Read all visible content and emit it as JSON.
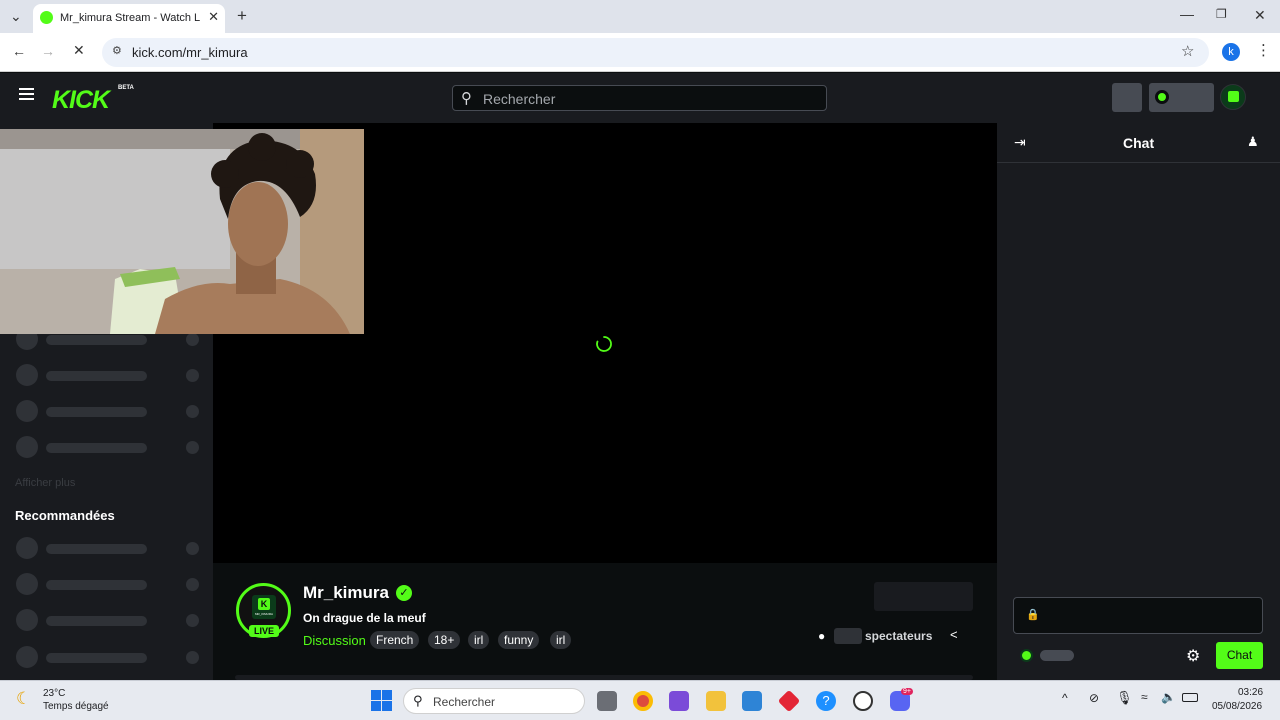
{
  "browser": {
    "tab_title": "Mr_kimura Stream - Watch Live",
    "url": "kick.com/mr_kimura",
    "profile_initial": "k"
  },
  "kick": {
    "logo_text": "KICK",
    "logo_badge": "BETA",
    "search_placeholder": "Rechercher"
  },
  "sidebar": {
    "show_more": "Afficher plus",
    "recommended_heading": "Recommandées"
  },
  "stream": {
    "channel_avatar_letter": "K",
    "channel_avatar_sub": "MR_KIMURA",
    "live_badge": "LIVE",
    "channel_name": "Mr_kimura",
    "title": "On drague de la meuf",
    "category": "Discussion",
    "tags": [
      "French",
      "18+",
      "irl",
      "funny",
      "irl"
    ],
    "viewers_suffix": "spectateurs"
  },
  "chat": {
    "header": "Chat",
    "send_label": "Chat"
  },
  "taskbar": {
    "weather_temp": "23°C",
    "weather_desc": "Temps dégagé",
    "search_placeholder": "Rechercher",
    "time": "03:26",
    "date": "05/08/2026",
    "discord_badge": "9+"
  },
  "colors": {
    "kick_green": "#53fc18",
    "bg_dark": "#0b0e0f",
    "panel": "#191b1f"
  }
}
